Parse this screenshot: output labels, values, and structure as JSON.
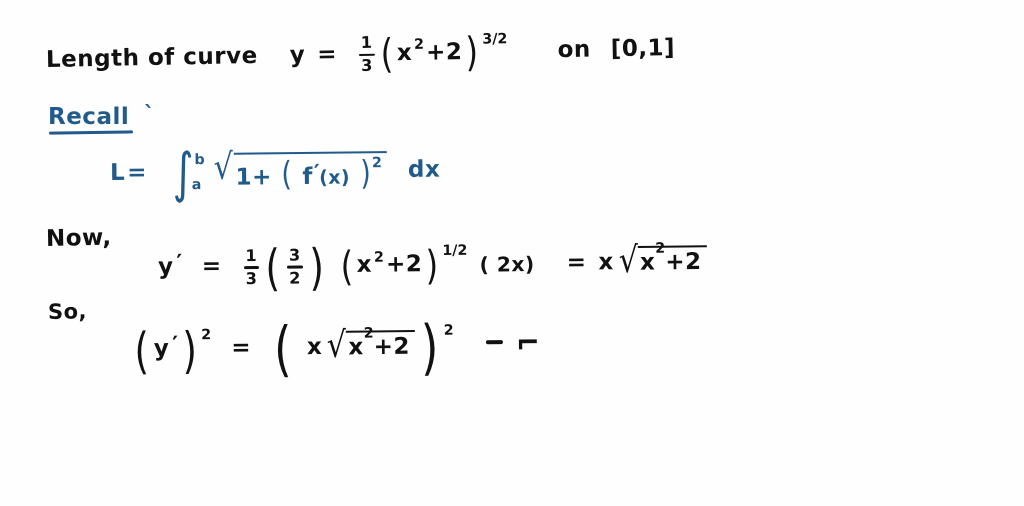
{
  "document": {
    "kind": "handwritten-math-notes",
    "background_color": "#fefefe",
    "ink_black": "#111111",
    "ink_blue": "#215b8c"
  },
  "line1": {
    "label": "Length of   curve",
    "y_var": "y",
    "equals": "=",
    "coef_num": "1",
    "coef_den": "3",
    "paren_open": "(",
    "base_x": "x",
    "base_x_exp": "2",
    "plus_two": "+2",
    "paren_close": ")",
    "exponent": "3/2",
    "on_word": "on",
    "interval": "[0,1]"
  },
  "line2": {
    "recall": "Recall",
    "colon_mark": "`",
    "L": "L",
    "equals": "=",
    "integral_sign": "∫",
    "upper_limit": "b",
    "lower_limit": "a",
    "radical_sign": "√",
    "radicand_one_plus": "1+",
    "paren_open": "(",
    "f_letter": "f",
    "prime": "′",
    "of_x": "(x)",
    "paren_close": ")",
    "squared": "2",
    "dx": "dx"
  },
  "line3": {
    "now": "Now,",
    "y_var": "y",
    "prime": "′",
    "equals": "=",
    "coef_num": "1",
    "coef_den": "3",
    "paren_open_a": "(",
    "frac2_num": "3",
    "frac2_den": "2",
    "paren_close_a": ")",
    "paren_open_b": "(",
    "base_x": "x",
    "base_x_exp": "2",
    "plus_two": "+2",
    "paren_close_b": ")",
    "exponent": "1/2",
    "factor": "( 2x)",
    "equals2": "=",
    "result_x": "x",
    "radical_sign": "√",
    "radicand": "x",
    "radicand_exp": "2",
    "radicand_plus": "+2"
  },
  "line4": {
    "so": "So,",
    "paren_open_outer": "(",
    "y_var": "y",
    "prime": "′",
    "paren_close_outer": ")",
    "squared_outer": "2",
    "equals": "=",
    "paren_open_big": "(",
    "x_letter": "x",
    "radical_sign": "√",
    "radicand": "x",
    "radicand_exp": "2",
    "radicand_plus": "+2",
    "paren_close_big": ")",
    "squared_big": "2",
    "trailing_stroke": "⌐"
  }
}
